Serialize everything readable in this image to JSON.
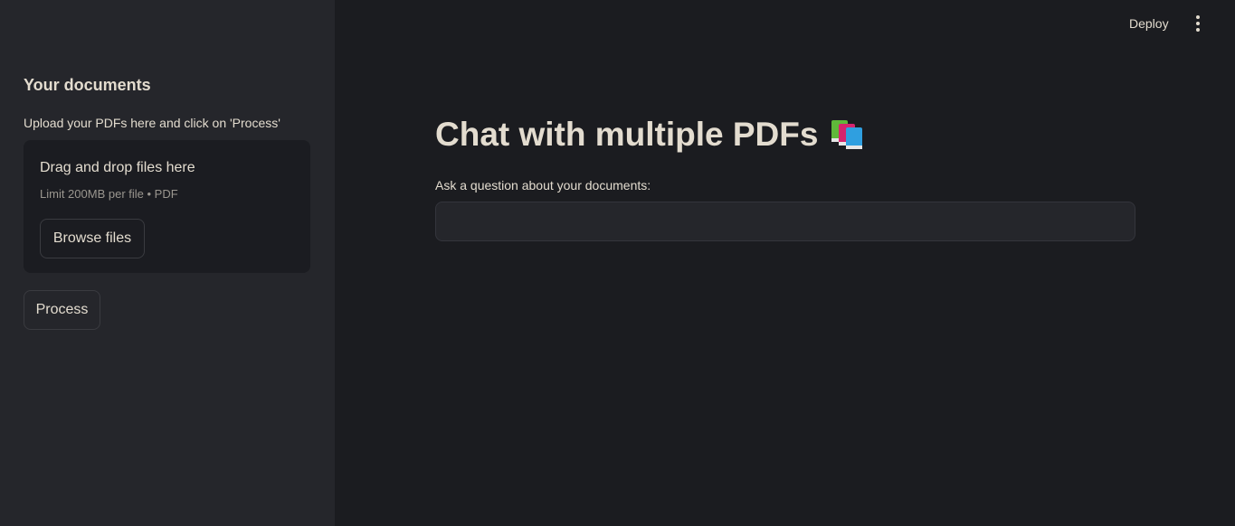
{
  "sidebar": {
    "title": "Your documents",
    "description": "Upload your PDFs here and click on 'Process'",
    "uploader": {
      "title": "Drag and drop files here",
      "limit": "Limit 200MB per file • PDF",
      "browse_label": "Browse files"
    },
    "process_label": "Process"
  },
  "header": {
    "deploy_label": "Deploy",
    "menu_icon": "vertical-ellipsis-icon"
  },
  "main": {
    "title": "Chat with multiple PDFs",
    "title_icon": "books-icon",
    "question_label": "Ask a question about your documents:",
    "question_value": ""
  },
  "colors": {
    "sidebar_bg": "#25262b",
    "main_bg": "#1b1c20",
    "text": "#e3dccf",
    "muted_text": "#9a968f"
  }
}
